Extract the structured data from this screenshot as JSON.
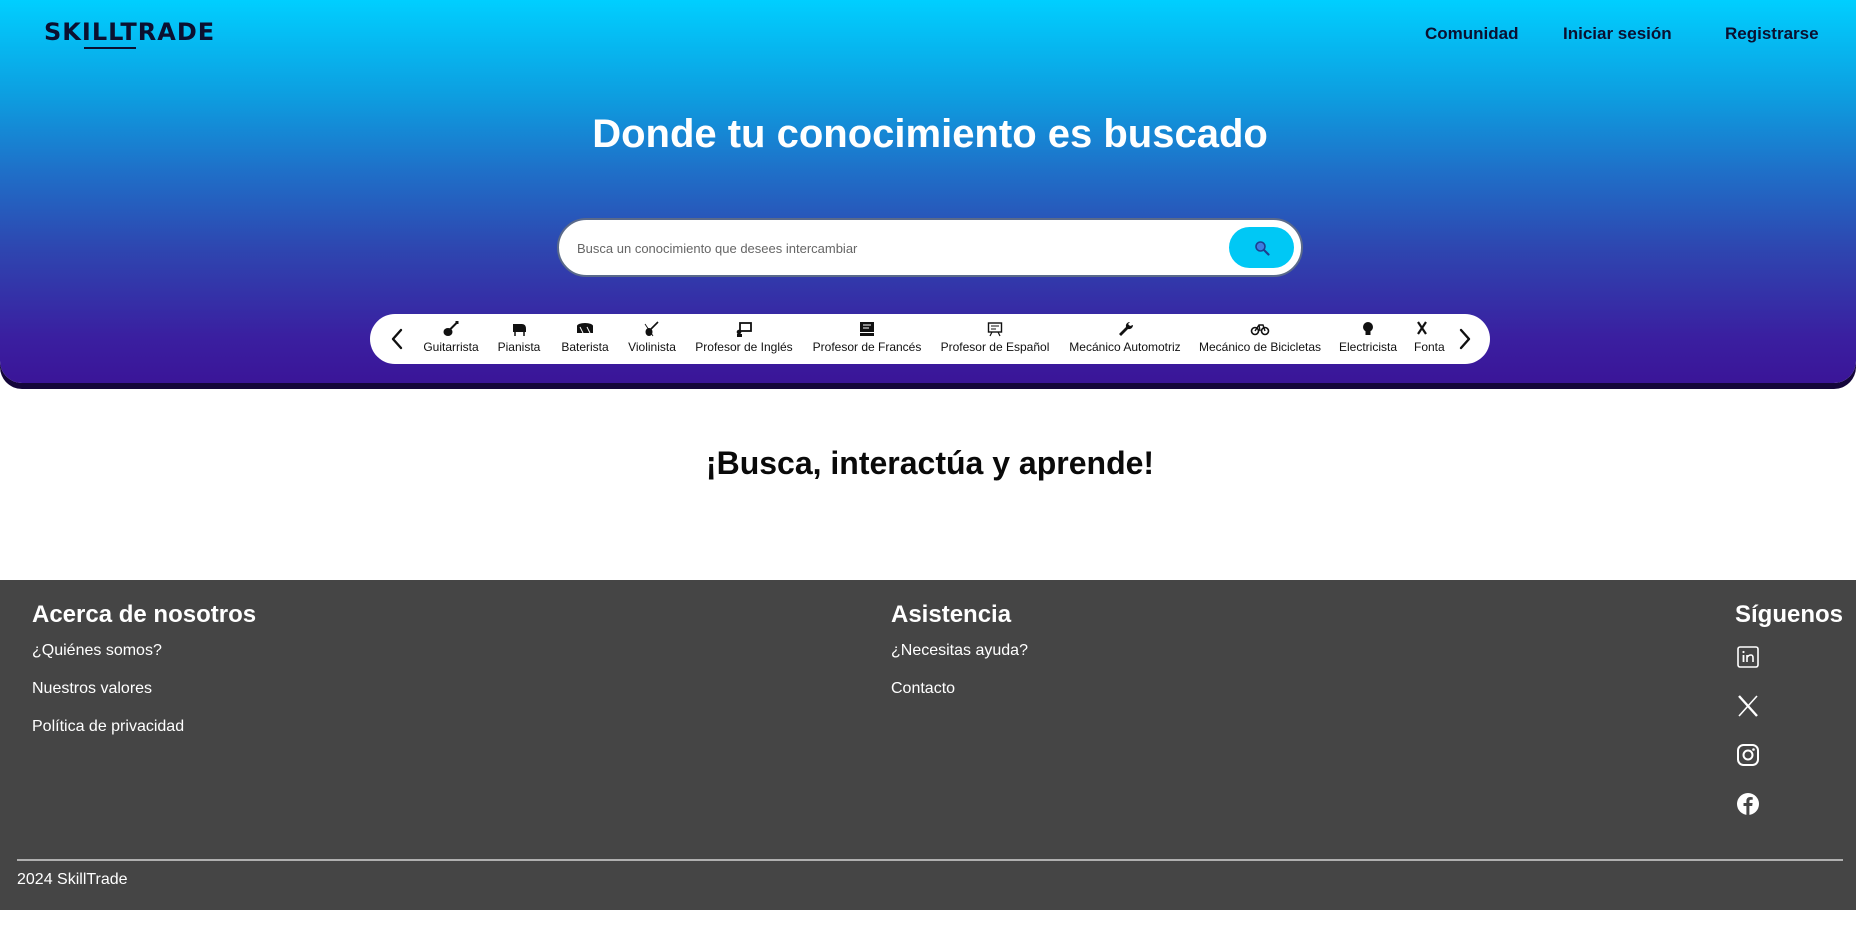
{
  "brand": {
    "logo_text": "SKILLTRADE"
  },
  "nav": {
    "community": "Comunidad",
    "login": "Iniciar sesión",
    "register": "Registrarse"
  },
  "hero": {
    "title": "Donde tu conocimiento es buscado"
  },
  "search": {
    "placeholder": "Busca un conocimiento que desees intercambiar",
    "button_icon": "search-icon"
  },
  "categories": [
    {
      "label": "Guitarrista",
      "icon": "guitar-icon"
    },
    {
      "label": "Pianista",
      "icon": "piano-icon"
    },
    {
      "label": "Baterista",
      "icon": "drum-icon"
    },
    {
      "label": "Violinista",
      "icon": "violin-icon"
    },
    {
      "label": "Profesor de Inglés",
      "icon": "teacher-board-icon"
    },
    {
      "label": "Profesor de Francés",
      "icon": "chalkboard-icon"
    },
    {
      "label": "Profesor de Español",
      "icon": "classroom-icon"
    },
    {
      "label": "Mecánico Automotriz",
      "icon": "wrench-icon"
    },
    {
      "label": "Mecánico de Bicicletas",
      "icon": "bicycle-icon"
    },
    {
      "label": "Electricista",
      "icon": "lightbulb-icon"
    },
    {
      "label": "Fonta",
      "icon": "plumbing-icon"
    }
  ],
  "main": {
    "subtitle": "¡Busca, interactúa y aprende!"
  },
  "footer": {
    "about": {
      "heading": "Acerca de nosotros",
      "links": [
        "¿Quiénes somos?",
        "Nuestros valores",
        "Política de privacidad"
      ]
    },
    "support": {
      "heading": "Asistencia",
      "links": [
        "¿Necesitas ayuda?",
        "Contacto"
      ]
    },
    "social": {
      "heading": "Síguenos",
      "icons": [
        "linkedin-icon",
        "x-icon",
        "instagram-icon",
        "facebook-icon"
      ]
    },
    "copyright": "2024 SkillTrade"
  },
  "colors": {
    "accent": "#00c8f5",
    "footer_bg": "#454545",
    "nav_text": "#0b1030"
  }
}
